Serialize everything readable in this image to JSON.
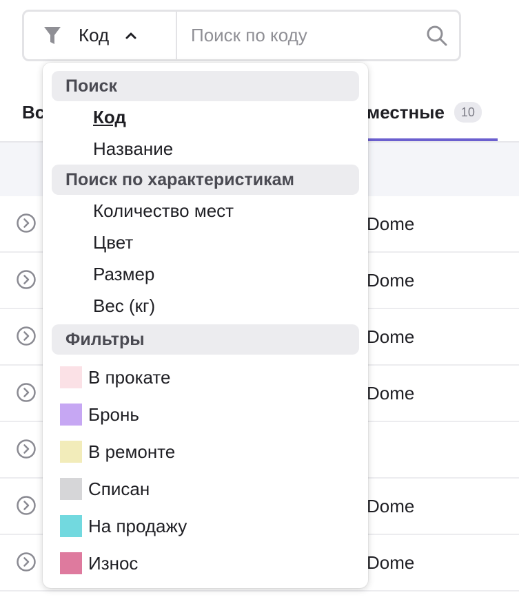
{
  "search": {
    "selected_field": "Код",
    "placeholder": "Поиск по коду",
    "value": ""
  },
  "tabs": {
    "first_label_partial": "Вс",
    "local_label": "местные",
    "local_count": "10"
  },
  "rows": [
    {
      "text": "Dome"
    },
    {
      "text": "Dome"
    },
    {
      "text": "Dome"
    },
    {
      "text": "Dome"
    },
    {
      "text": ""
    },
    {
      "text": "Dome"
    },
    {
      "text": "Dome"
    }
  ],
  "dropdown": {
    "search_group": {
      "label": "Поиск",
      "options": [
        "Код",
        "Название"
      ]
    },
    "attr_group": {
      "label": "Поиск по характеристикам",
      "options": [
        "Количество мест",
        "Цвет",
        "Размер",
        "Вес (кг)"
      ]
    },
    "filter_group": {
      "label": "Фильтры",
      "options": [
        {
          "label": "В прокате",
          "color": "#fbe1e6"
        },
        {
          "label": "Бронь",
          "color": "#c6a7f3"
        },
        {
          "label": "В ремонте",
          "color": "#f2ecba"
        },
        {
          "label": "Списан",
          "color": "#d6d6d8"
        },
        {
          "label": "На продажу",
          "color": "#72d9df"
        },
        {
          "label": "Износ",
          "color": "#de7a9e"
        }
      ]
    }
  },
  "colors": {
    "accent": "#6b5fcf"
  }
}
